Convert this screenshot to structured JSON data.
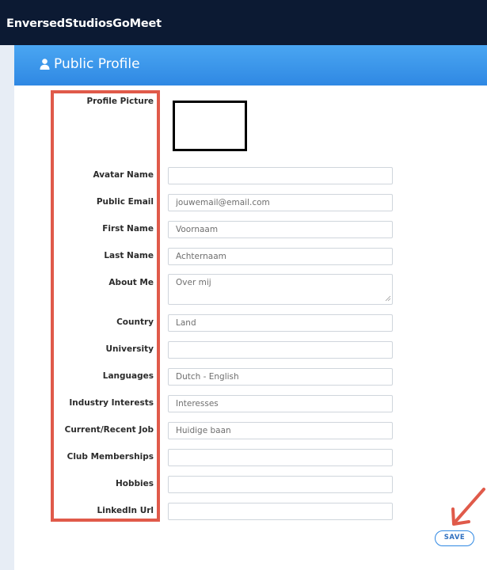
{
  "app": {
    "title": "EnversedStudiosGoMeet"
  },
  "section": {
    "title": "Public Profile",
    "icon": "user-icon"
  },
  "fields": [
    {
      "label": "Profile Picture",
      "type": "image",
      "value": ""
    },
    {
      "label": "Avatar Name",
      "type": "text",
      "value": "",
      "placeholder": ""
    },
    {
      "label": "Public Email",
      "type": "text",
      "value": "",
      "placeholder": "jouwemail@email.com"
    },
    {
      "label": "First Name",
      "type": "text",
      "value": "",
      "placeholder": "Voornaam"
    },
    {
      "label": "Last Name",
      "type": "text",
      "value": "",
      "placeholder": "Achternaam"
    },
    {
      "label": "About Me",
      "type": "textarea",
      "value": "",
      "placeholder": "Over mij"
    },
    {
      "label": "Country",
      "type": "text",
      "value": "",
      "placeholder": "Land"
    },
    {
      "label": "University",
      "type": "text",
      "value": "",
      "placeholder": ""
    },
    {
      "label": "Languages",
      "type": "text",
      "value": "",
      "placeholder": "Dutch - English"
    },
    {
      "label": "Industry Interests",
      "type": "text",
      "value": "",
      "placeholder": "Interesses"
    },
    {
      "label": "Current/Recent Job",
      "type": "text",
      "value": "",
      "placeholder": "Huidige baan"
    },
    {
      "label": "Club Memberships",
      "type": "text",
      "value": "",
      "placeholder": ""
    },
    {
      "label": "Hobbies",
      "type": "text",
      "value": "",
      "placeholder": ""
    },
    {
      "label": "LinkedIn Url",
      "type": "text",
      "value": "",
      "placeholder": ""
    }
  ],
  "actions": {
    "save_label": "SAVE"
  },
  "colors": {
    "topbar": "#0c1a33",
    "header_accent": "#2f88e3",
    "highlight": "#e05a4a",
    "arrow": "#e05a4a"
  }
}
